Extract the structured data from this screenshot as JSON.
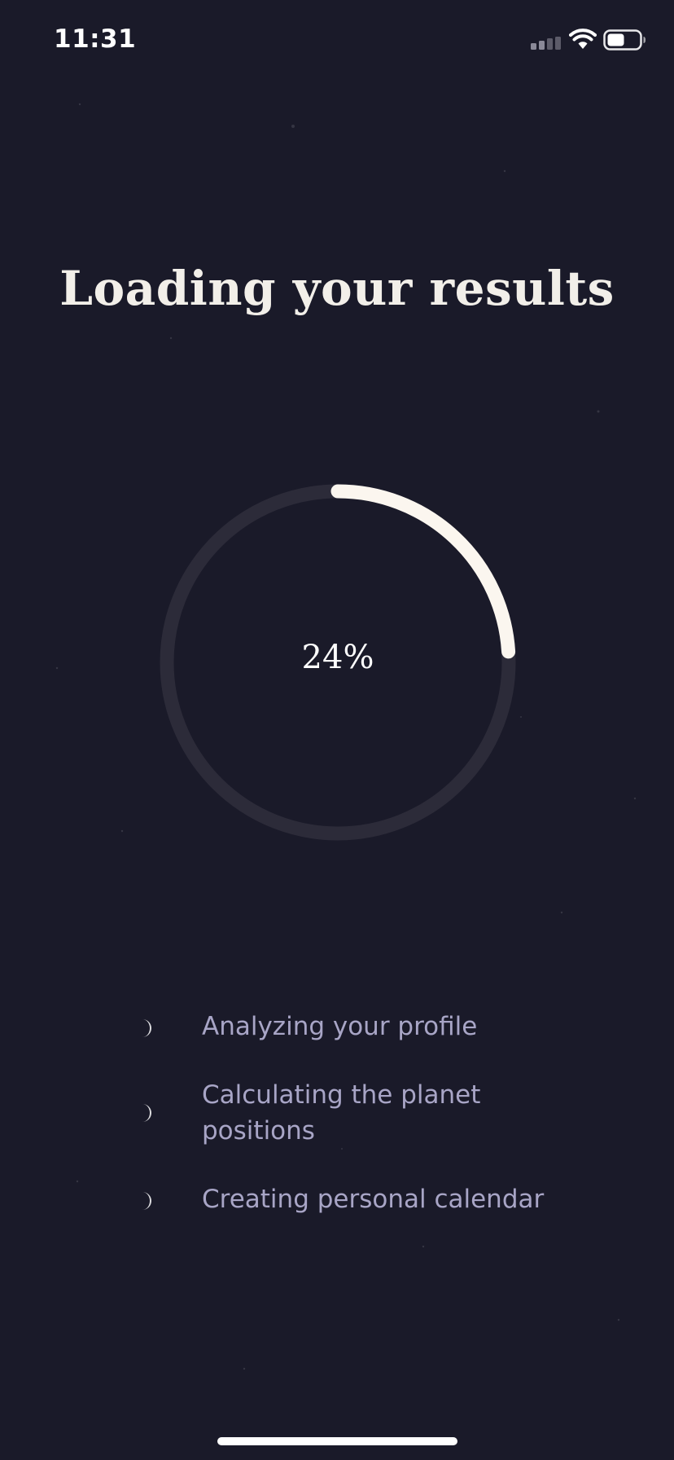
{
  "status_bar": {
    "time": "11:31",
    "icons": [
      "signal-icon",
      "wifi-icon",
      "battery-icon"
    ]
  },
  "title": "Loading your results",
  "progress": {
    "value": 0.24,
    "label": "24%"
  },
  "steps": [
    {
      "label": "Analyzing your profile",
      "icon": "moon-icon"
    },
    {
      "label": "Calculating the planet positions",
      "icon": "moon-icon"
    },
    {
      "label": "Creating personal calendar",
      "icon": "moon-icon"
    }
  ],
  "colors": {
    "background": "#1a1a29",
    "ring_track": "#2c2b39",
    "ring_progress": "#fbf6ef",
    "title": "#f2efe9",
    "step_text": "#a8a5c6"
  }
}
